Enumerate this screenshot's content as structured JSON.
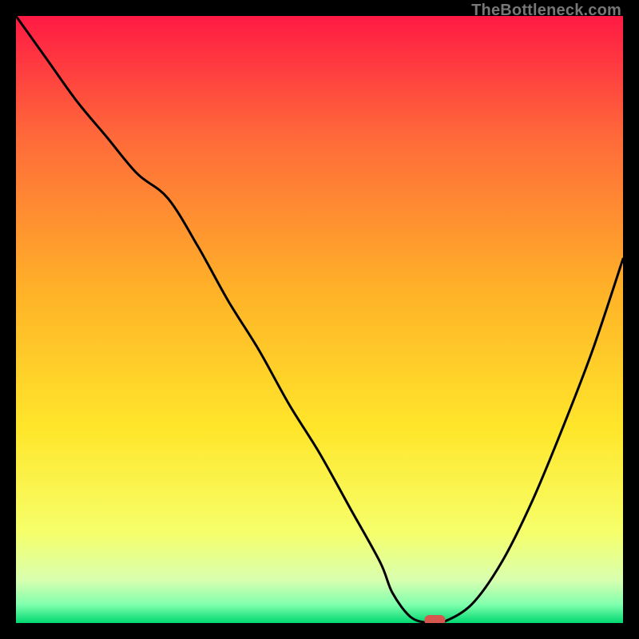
{
  "watermark": "TheBottleneck.com",
  "chart_data": {
    "type": "line",
    "title": "",
    "xlabel": "",
    "ylabel": "",
    "xlim": [
      0,
      100
    ],
    "ylim": [
      0,
      100
    ],
    "x": [
      0,
      5,
      10,
      15,
      20,
      25,
      30,
      35,
      40,
      45,
      50,
      55,
      60,
      62,
      65,
      68,
      70,
      75,
      80,
      85,
      90,
      95,
      100
    ],
    "values": [
      100,
      93,
      86,
      80,
      74,
      70,
      62,
      53,
      45,
      36,
      28,
      19,
      10,
      5,
      1,
      0,
      0,
      3,
      10,
      20,
      32,
      45,
      60
    ],
    "marker": {
      "x": 69,
      "y": 0
    },
    "axis_visible": false,
    "grid": false,
    "legend": null,
    "background_gradient": {
      "top": "#ff1a44",
      "mid_upper": "#ff6a3a",
      "mid": "#ffb128",
      "mid_lower": "#ffe62a",
      "lower": "#f6ff6a",
      "band": "#d8ffb0",
      "bottom": "#00d870"
    }
  }
}
